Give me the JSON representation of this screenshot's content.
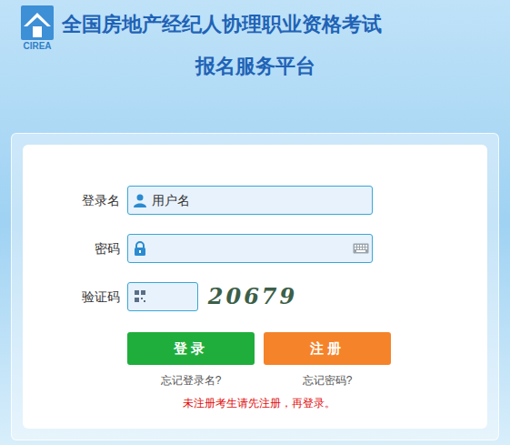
{
  "logo": {
    "text": "CIREA"
  },
  "header": {
    "title": "全国房地产经纪人协理职业资格考试",
    "subtitle": "报名服务平台"
  },
  "form": {
    "fields": [
      {
        "label": "登录名",
        "kind": "username",
        "placeholder": "用户名"
      },
      {
        "label": "密码",
        "kind": "password"
      },
      {
        "label": "验证码",
        "kind": "captcha",
        "code": "20679"
      }
    ],
    "buttons": [
      {
        "label": "登录",
        "color": "#1fae3c"
      },
      {
        "label": "注册",
        "color": "#f5832a"
      }
    ],
    "links": [
      "忘记登录名?",
      "忘记密码?"
    ],
    "notice": "未注册考生请先注册，再登录。"
  }
}
